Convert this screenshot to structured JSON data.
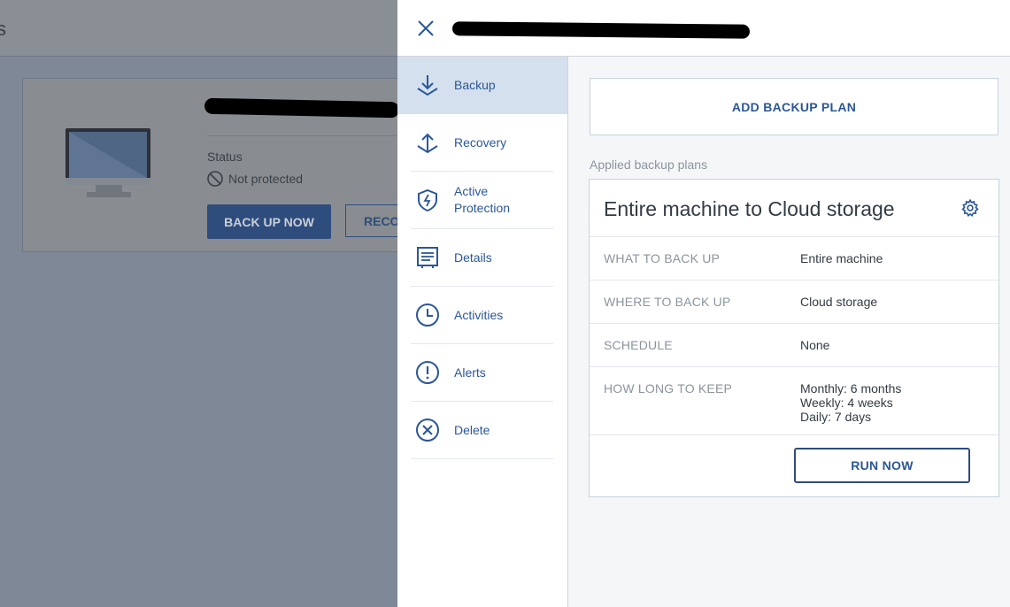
{
  "background": {
    "header_text": "s",
    "status_label": "Status",
    "status_value": "Not protected",
    "back_up_now_label": "BACK UP NOW",
    "recovery_label": "RECO"
  },
  "panel": {
    "sidebar": {
      "items": [
        {
          "label": "Backup",
          "icon": "backup-icon",
          "active": true
        },
        {
          "label": "Recovery",
          "icon": "recovery-icon"
        },
        {
          "label": "Active Protection",
          "icon": "shield-icon"
        },
        {
          "label": "Details",
          "icon": "details-icon"
        },
        {
          "label": "Activities",
          "icon": "clock-icon"
        },
        {
          "label": "Alerts",
          "icon": "alert-icon"
        },
        {
          "label": "Delete",
          "icon": "delete-icon"
        }
      ]
    },
    "add_backup_plan_label": "ADD BACKUP PLAN",
    "applied_plans_label": "Applied backup plans",
    "plan": {
      "title": "Entire machine to Cloud storage",
      "rows": [
        {
          "key": "WHAT TO BACK UP",
          "value": "Entire machine"
        },
        {
          "key": "WHERE TO BACK UP",
          "value": "Cloud storage"
        },
        {
          "key": "SCHEDULE",
          "value": "None"
        },
        {
          "key": "HOW LONG TO KEEP",
          "value_lines": [
            "Monthly: 6 months",
            "Weekly: 4 weeks",
            "Daily: 7 days"
          ]
        }
      ],
      "run_now_label": "RUN NOW"
    }
  },
  "colors": {
    "accent": "#2b5797",
    "active_item_bg": "#d5e0ee",
    "button_dark": "#2e4c7c"
  }
}
